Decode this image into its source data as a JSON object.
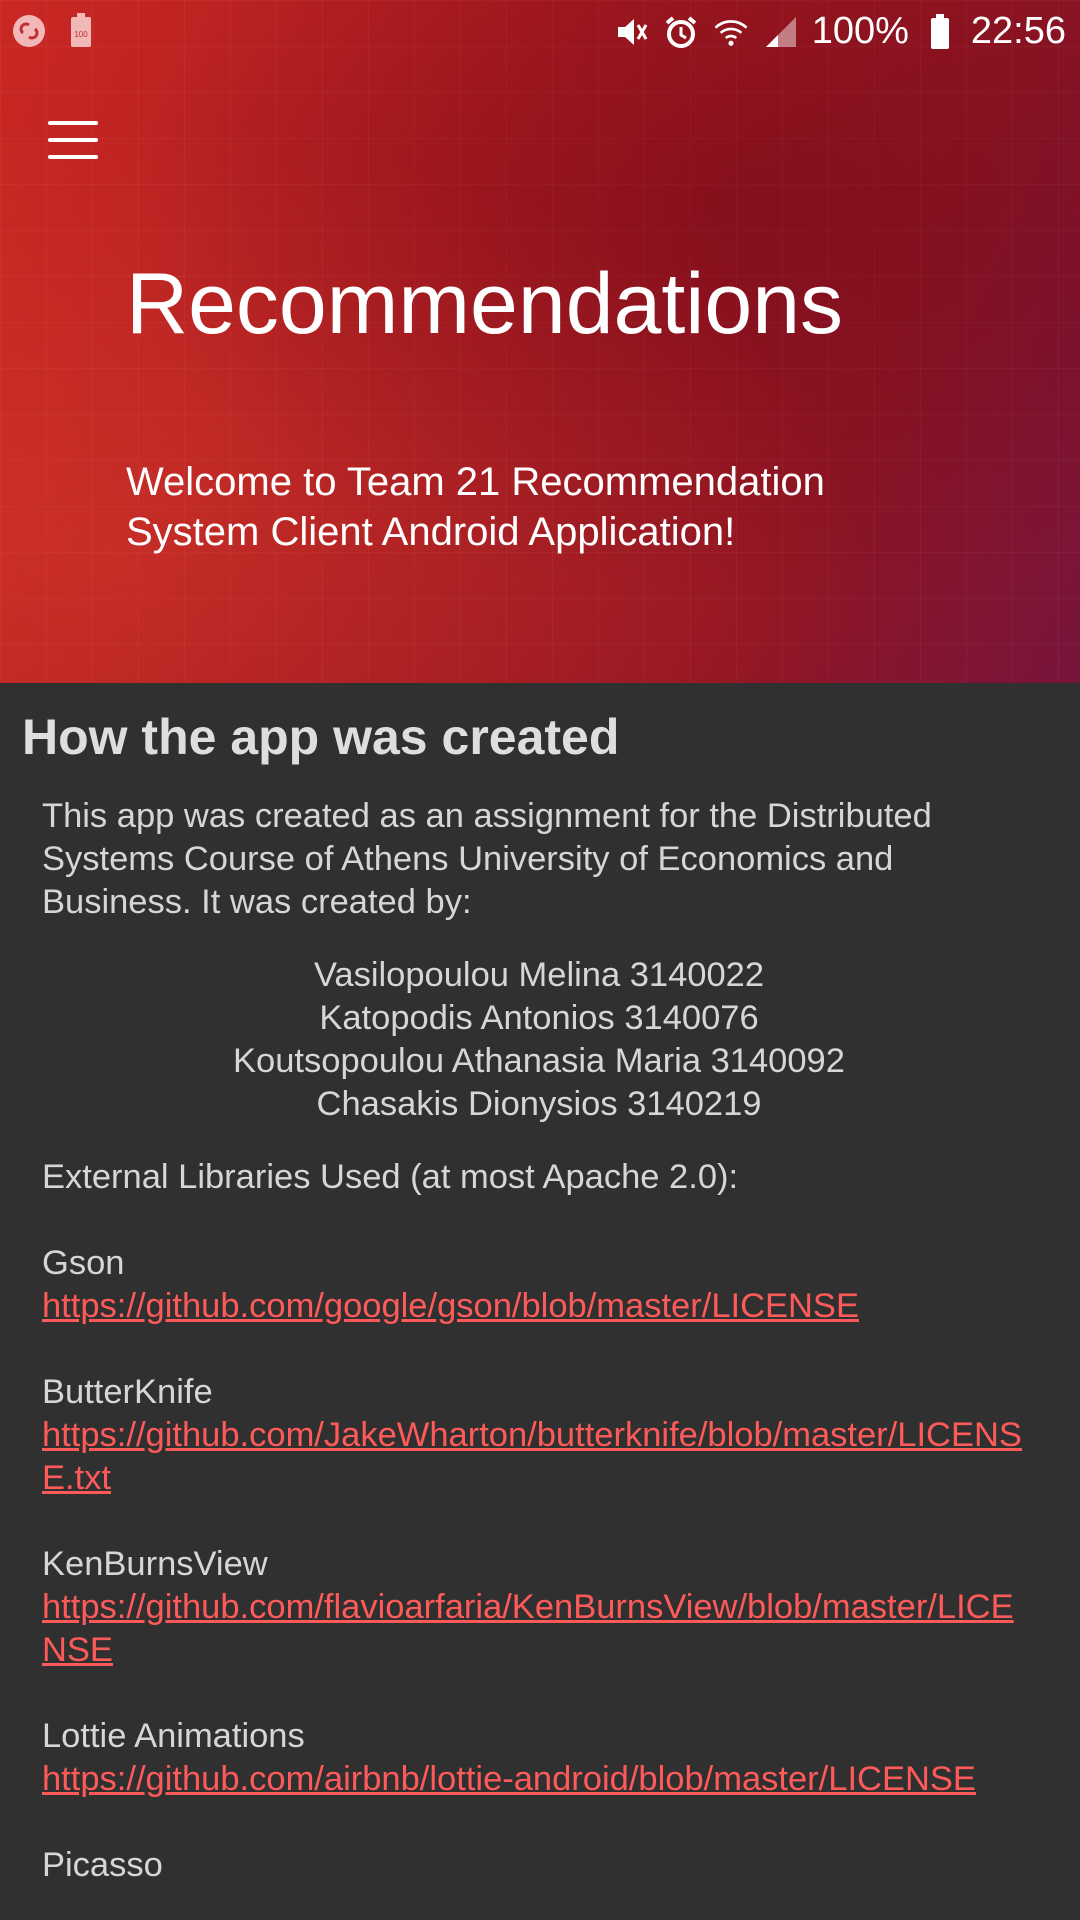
{
  "status_bar": {
    "battery_percent": "100%",
    "time": "22:56",
    "left_icons": [
      "shazam-icon",
      "battery-saver-icon"
    ],
    "right_icons": [
      "mute-icon",
      "alarm-icon",
      "wifi-icon",
      "signal-icon",
      "battery-icon"
    ]
  },
  "header": {
    "title": "Recommendations",
    "subtitle": "Welcome to Team 21 Recommendation System Client Android Application!",
    "colors": {
      "primary": "#c8202a",
      "secondary": "#7d1740"
    }
  },
  "content": {
    "section_title": "How the app was created",
    "intro": "This app was created as an assignment for the Distributed Systems Course of Athens University of Economics and Business. It was created by:",
    "authors": [
      "Vasilopoulou Melina 3140022",
      "Katopodis Antonios 3140076",
      "Koutsopoulou Athanasia Maria 3140092",
      "Chasakis Dionysios 3140219"
    ],
    "libraries_title": "External Libraries Used (at most Apache 2.0):",
    "libraries": [
      {
        "name": "Gson",
        "url": "https://github.com/google/gson/blob/master/LICENSE"
      },
      {
        "name": "ButterKnife",
        "url": "https://github.com/JakeWharton/butterknife/blob/master/LICENSE.txt"
      },
      {
        "name": "KenBurnsView",
        "url": "https://github.com/flavioarfaria/KenBurnsView/blob/master/LICENSE"
      },
      {
        "name": "Lottie Animations",
        "url": "https://github.com/airbnb/lottie-android/blob/master/LICENSE"
      }
    ],
    "next_library_partial": "Picasso",
    "link_color": "#ff5a5a"
  }
}
